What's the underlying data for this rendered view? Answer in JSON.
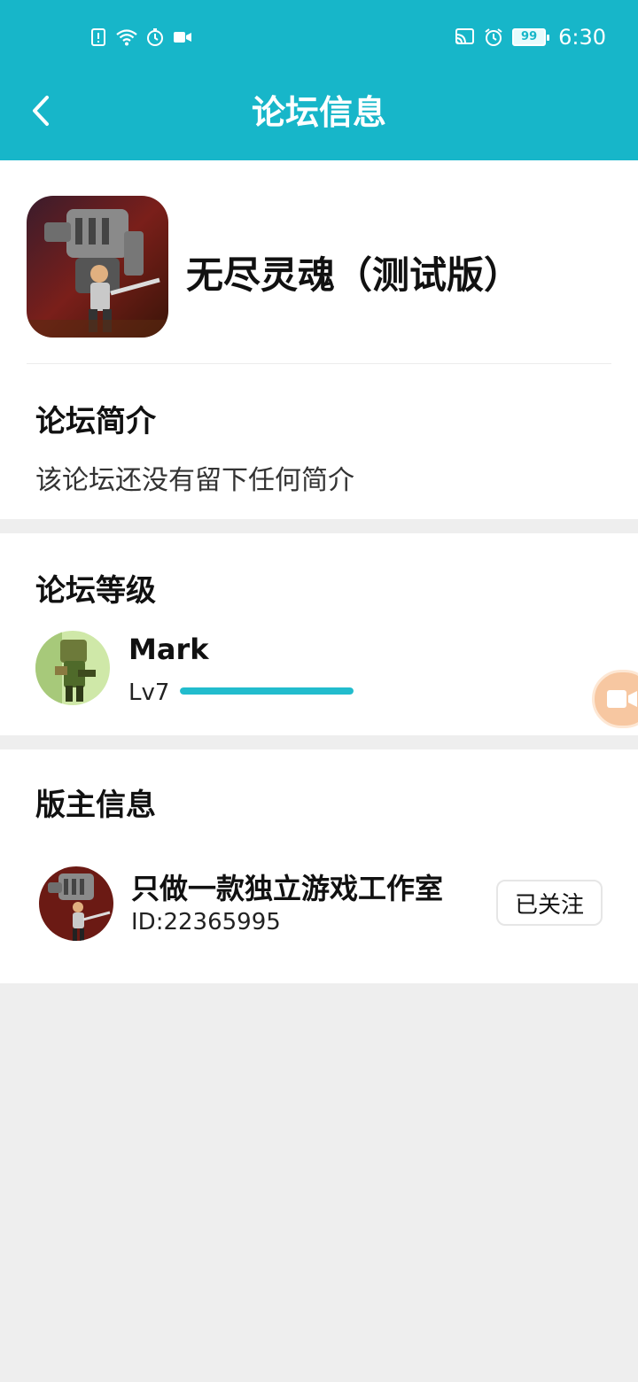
{
  "status_bar": {
    "time": "6:30",
    "battery": "99",
    "left_icons": [
      "sim-alert-icon",
      "wifi-icon",
      "timer-icon",
      "video-record-icon"
    ],
    "right_icons": [
      "cast-icon",
      "alarm-icon",
      "battery-icon"
    ]
  },
  "header": {
    "title": "论坛信息",
    "back_icon": "chevron-left-icon",
    "background_color": "#17b6c9"
  },
  "forum": {
    "name": "无尽灵魂（测试版）",
    "intro_title": "论坛简介",
    "intro_text": "该论坛还没有留下任何简介"
  },
  "level": {
    "section_title": "论坛等级",
    "user_name": "Mark",
    "level_label": "Lv7",
    "progress_fraction": 1.0,
    "progress_color": "#22bccd"
  },
  "moderator": {
    "section_title": "版主信息",
    "name": "只做一款独立游戏工作室",
    "id_text": "ID:22365995",
    "follow_label": "已关注"
  },
  "floating_button": {
    "icon": "video-camera-icon",
    "color": "#f7c7a1"
  }
}
